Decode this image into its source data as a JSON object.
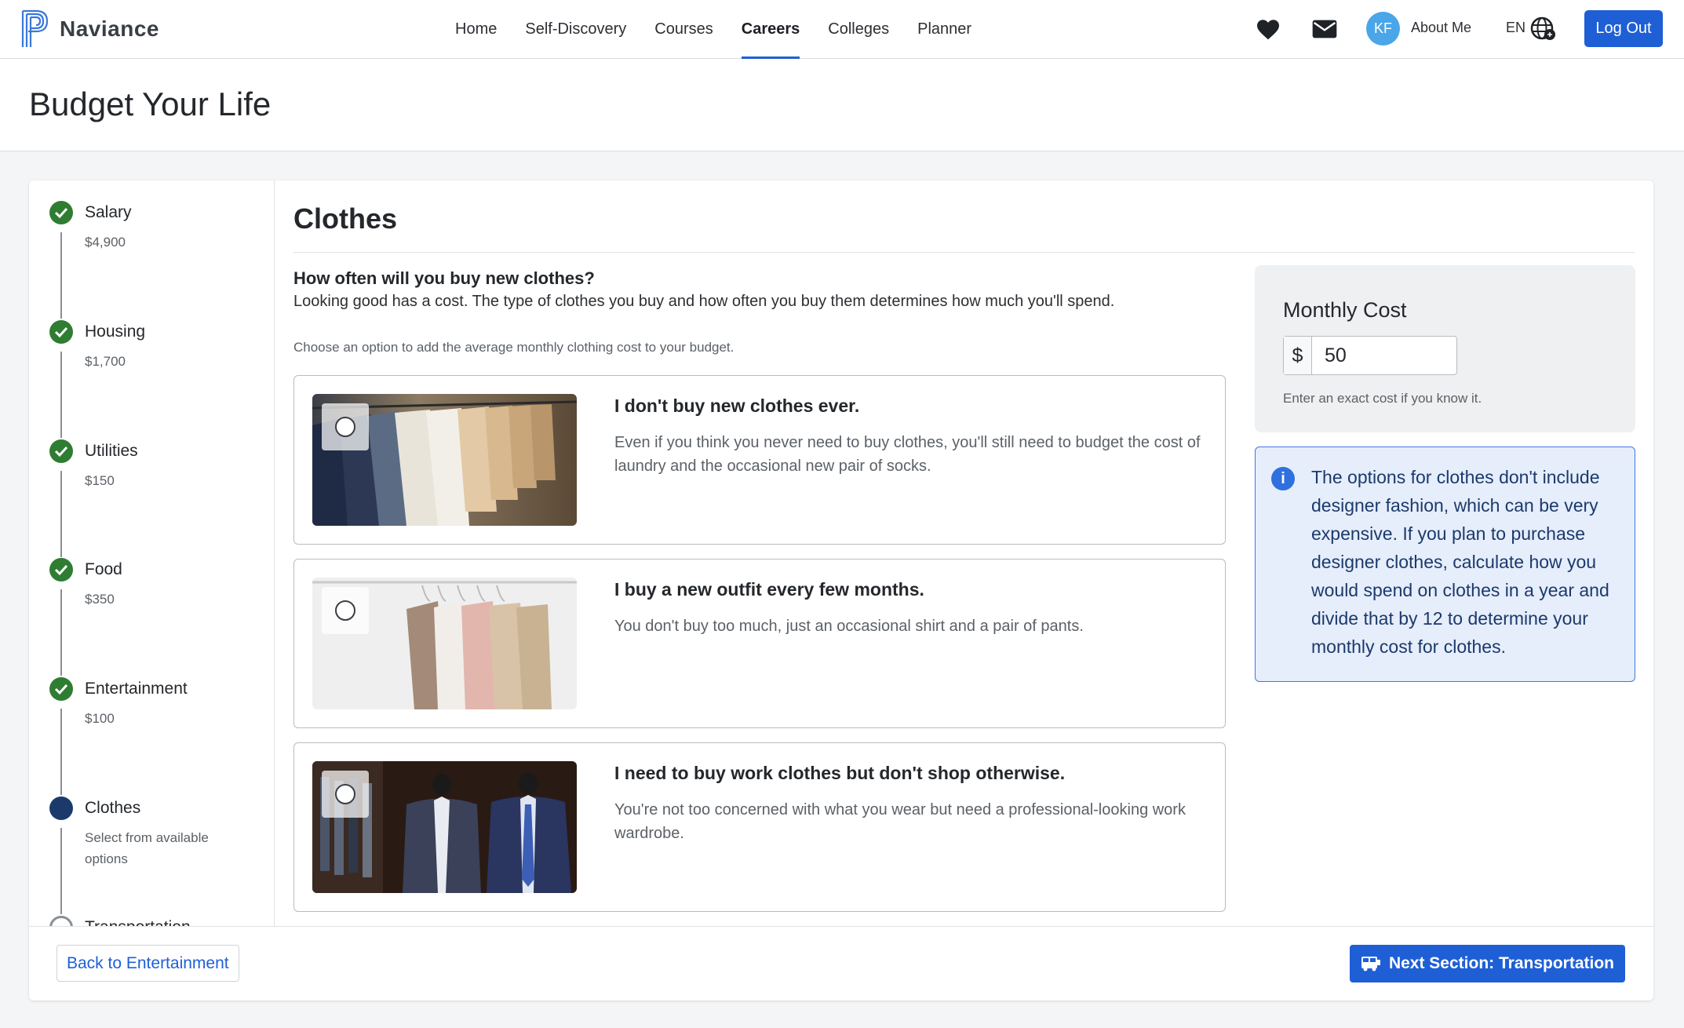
{
  "brand": {
    "name": "Naviance"
  },
  "nav": {
    "items": [
      {
        "label": "Home"
      },
      {
        "label": "Self-Discovery"
      },
      {
        "label": "Courses"
      },
      {
        "label": "Careers"
      },
      {
        "label": "Colleges"
      },
      {
        "label": "Planner"
      }
    ],
    "active": "Careers",
    "avatar_initials": "KF",
    "about_label": "About Me",
    "lang_label": "EN",
    "logout_label": "Log Out",
    "icons": [
      "heart-icon",
      "mail-icon",
      "globe-icon"
    ]
  },
  "page": {
    "title": "Budget Your Life"
  },
  "steps": [
    {
      "name": "Salary",
      "sub": "$4,900",
      "status": "done"
    },
    {
      "name": "Housing",
      "sub": "$1,700",
      "status": "done"
    },
    {
      "name": "Utilities",
      "sub": "$150",
      "status": "done"
    },
    {
      "name": "Food",
      "sub": "$350",
      "status": "done"
    },
    {
      "name": "Entertainment",
      "sub": "$100",
      "status": "done"
    },
    {
      "name": "Clothes",
      "sub": "Select from available options",
      "status": "current"
    },
    {
      "name": "Transportation",
      "sub": "",
      "status": "todo"
    }
  ],
  "section": {
    "title": "Clothes",
    "question": "How often will you buy new clothes?",
    "description": "Looking good has a cost. The type of clothes you buy and how often you buy them determines how much you'll spend.",
    "hint": "Choose an option to add the average monthly clothing cost to your budget."
  },
  "options": [
    {
      "title": "I don't buy new clothes ever.",
      "desc": "Even if you think you never need to buy clothes, you'll still need to budget the cost of laundry and the occasional new pair of socks.",
      "image": "clothes-rack-photo"
    },
    {
      "title": "I buy a new outfit every few months.",
      "desc": "You don't buy too much, just an occasional shirt and a pair of pants.",
      "image": "sweaters-on-hangers-photo"
    },
    {
      "title": "I need to buy work clothes but don't shop otherwise.",
      "desc": "You're not too concerned with what you wear but need a professional-looking work wardrobe.",
      "image": "suits-on-mannequins-photo"
    }
  ],
  "cost": {
    "label": "Monthly Cost",
    "prefix": "$",
    "value": "50",
    "help": "Enter an exact cost if you know it."
  },
  "info": {
    "text": "The options for clothes don't include designer fashion, which can be very expensive. If you plan to purchase designer clothes, calculate how you would spend on clothes in a year and divide that by 12 to determine your monthly cost for clothes."
  },
  "footer": {
    "back_label": "Back to Entertainment",
    "next_label": "Next Section: Transportation"
  },
  "colors": {
    "accent": "#1f5fd6",
    "done": "#2e7d32",
    "current": "#1b3a6b",
    "info_bg": "#e6edfb"
  }
}
